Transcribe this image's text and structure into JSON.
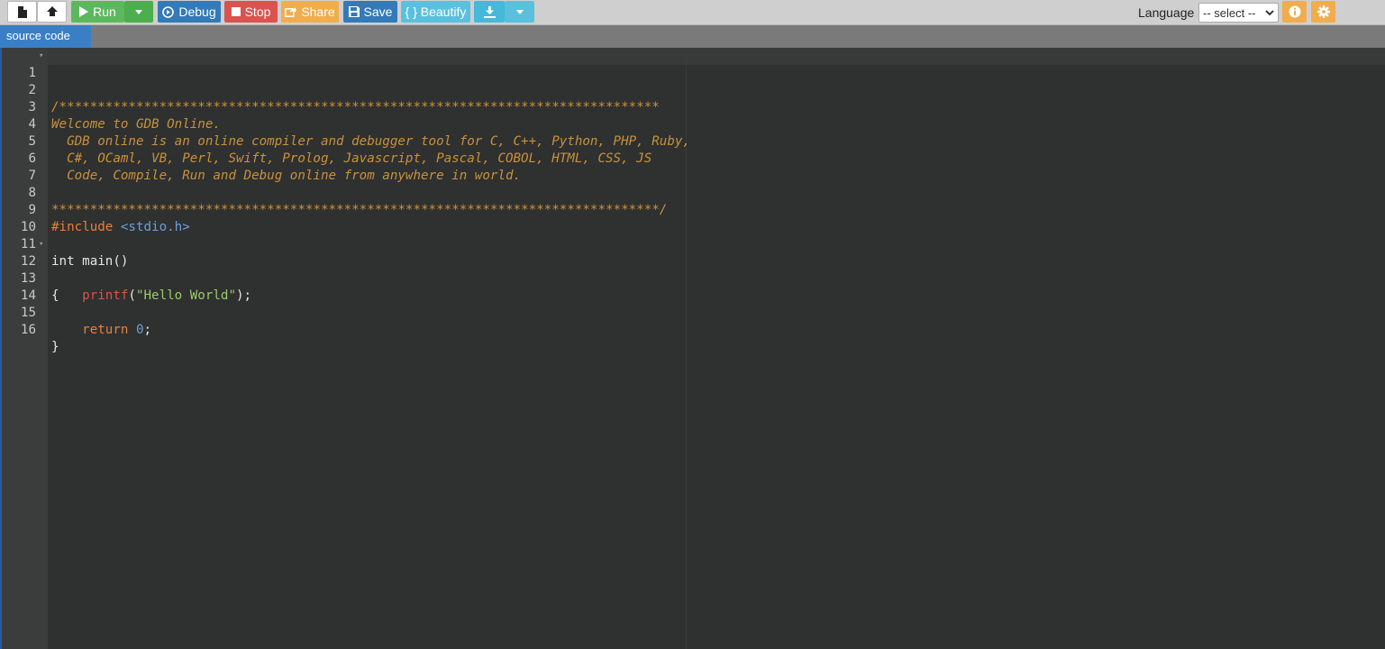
{
  "toolbar": {
    "new_file_icon": "file-icon",
    "upload_icon": "upload-icon",
    "run": {
      "label": "Run",
      "color": "#5cb85c"
    },
    "debug": {
      "label": "Debug",
      "color": "#337ab7"
    },
    "stop": {
      "label": "Stop",
      "color": "#d9534f"
    },
    "share": {
      "label": "Share",
      "color": "#f0ad4e"
    },
    "save": {
      "label": "Save",
      "color": "#337ab7"
    },
    "beautify": {
      "label": "{ } Beautify",
      "color": "#5bc0de"
    },
    "language_label": "Language",
    "language_select_value": "-- select --"
  },
  "tabs": [
    {
      "label": "source code",
      "active": true
    }
  ],
  "editor": {
    "lines": [
      {
        "n": "1",
        "fold": true,
        "text": "/******************************************************************************"
      },
      {
        "n": "2",
        "fold": false,
        "text": ""
      },
      {
        "n": "3",
        "fold": false,
        "text": "Welcome to GDB Online."
      },
      {
        "n": "4",
        "fold": false,
        "text": "  GDB online is an online compiler and debugger tool for C, C++, Python, PHP, Ruby,"
      },
      {
        "n": "5",
        "fold": false,
        "text": "  C#, OCaml, VB, Perl, Swift, Prolog, Javascript, Pascal, COBOL, HTML, CSS, JS"
      },
      {
        "n": "6",
        "fold": false,
        "text": "  Code, Compile, Run and Debug online from anywhere in world."
      },
      {
        "n": "7",
        "fold": false,
        "text": ""
      },
      {
        "n": "8",
        "fold": false,
        "text": "*******************************************************************************/"
      },
      {
        "n": "9",
        "fold": false,
        "text": "#include <stdio.h>"
      },
      {
        "n": "10",
        "fold": false,
        "text": ""
      },
      {
        "n": "11",
        "fold": false,
        "text": "int main()"
      },
      {
        "n": "12",
        "fold": true,
        "text": "{"
      },
      {
        "n": "13",
        "fold": false,
        "text": "    printf(\"Hello World\");"
      },
      {
        "n": "14",
        "fold": false,
        "text": ""
      },
      {
        "n": "15",
        "fold": false,
        "text": "    return 0;"
      },
      {
        "n": "16",
        "fold": false,
        "text": "}"
      }
    ],
    "tokens": {
      "include_kw": "#include",
      "include_file": "<stdio.h>",
      "printf_fn": "printf",
      "printf_open": "(",
      "hello_str": "\"Hello World\"",
      "printf_close": ");",
      "return_kw": "return",
      "return_num": "0",
      "semicolon": ";"
    }
  }
}
